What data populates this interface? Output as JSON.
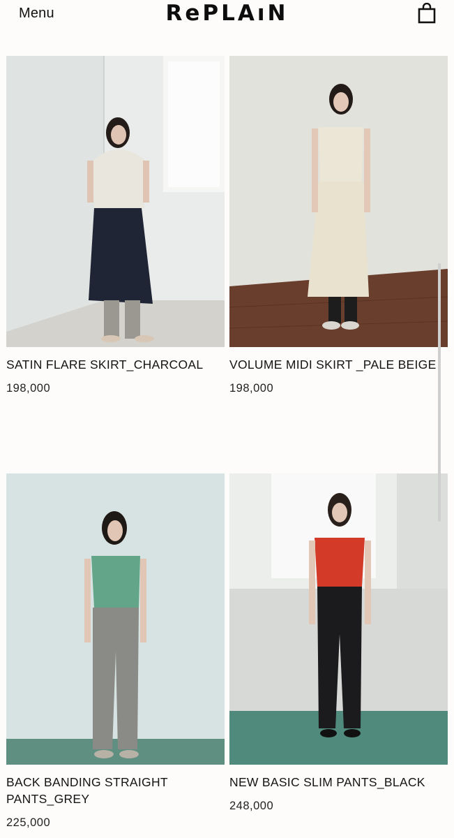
{
  "header": {
    "menu_label": "Menu",
    "logo_text": "RePLAıN",
    "cart_icon": "shopping-bag-icon"
  },
  "products": [
    {
      "name": "SATIN FLARE SKIRT_CHARCOAL",
      "price": "198,000",
      "photo": {
        "background": "#dfe3e1",
        "floor": "#d3d2cc",
        "top": "#e9e6dd",
        "bottom": "#1f2535",
        "legs": "#9a9891"
      }
    },
    {
      "name": "VOLUME MIDI SKIRT _PALE BEIGE",
      "price": "198,000",
      "photo": {
        "background": "#e2e2dd",
        "floor": "#6a3e2c",
        "top": "#ece6d6",
        "bottom": "#e8e2cf",
        "legs": "#1d1d1d"
      }
    },
    {
      "name": "BACK BANDING STRAIGHT PANTS_GREY",
      "price": "225,000",
      "photo": {
        "background": "#d6e3e2",
        "floor": "#5e8f80",
        "top": "#62a588",
        "bottom": "#8a8a86",
        "legs": "#8a8a86"
      }
    },
    {
      "name": "NEW BASIC SLIM PANTS_BLACK",
      "price": "248,000",
      "photo": {
        "background": "#dcdedb",
        "floor": "#4f8a7c",
        "top": "#d43a28",
        "bottom": "#1b1b1e",
        "legs": "#1b1b1e"
      }
    }
  ]
}
